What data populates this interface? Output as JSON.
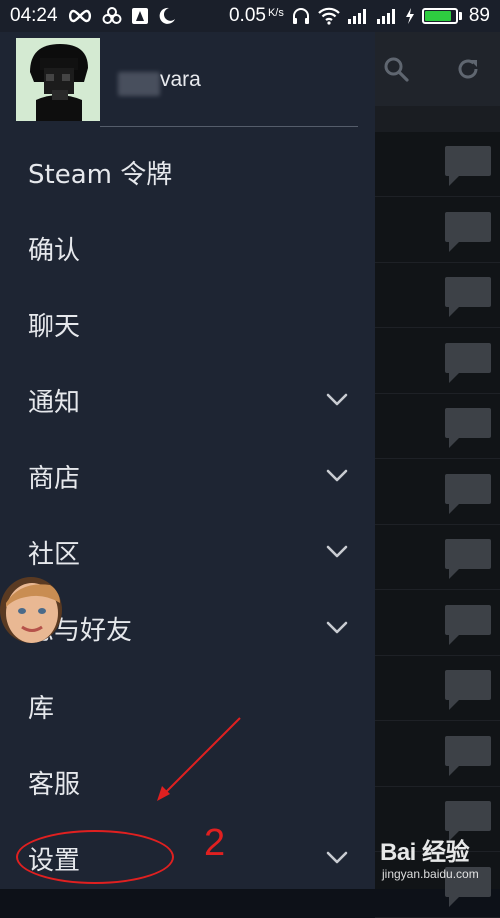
{
  "status_bar": {
    "time": "04:24",
    "speed": "0.05",
    "speed_unit": "K/s",
    "battery": "89",
    "battery_level": 0.89,
    "battery_color": "#2ecc40"
  },
  "profile": {
    "username": "vara",
    "avatar_icon": "user-avatar"
  },
  "menu": {
    "items": [
      {
        "label": "Steam 令牌",
        "has_chevron": false
      },
      {
        "label": "确认",
        "has_chevron": false
      },
      {
        "label": "聊天",
        "has_chevron": false
      },
      {
        "label": "通知",
        "has_chevron": true
      },
      {
        "label": "商店",
        "has_chevron": true
      },
      {
        "label": "社区",
        "has_chevron": true
      },
      {
        "label": "您与好友",
        "has_chevron": true
      },
      {
        "label": "库",
        "has_chevron": false
      },
      {
        "label": "客服",
        "has_chevron": false
      },
      {
        "label": "设置",
        "has_chevron": true
      }
    ]
  },
  "annotation": {
    "number": "2",
    "color": "#e02020"
  },
  "watermark": {
    "main": "Bai 经验",
    "sub": "jingyan.baidu.com"
  },
  "colors": {
    "drawer_bg": "#1e2533",
    "text": "#e6e8ec"
  }
}
